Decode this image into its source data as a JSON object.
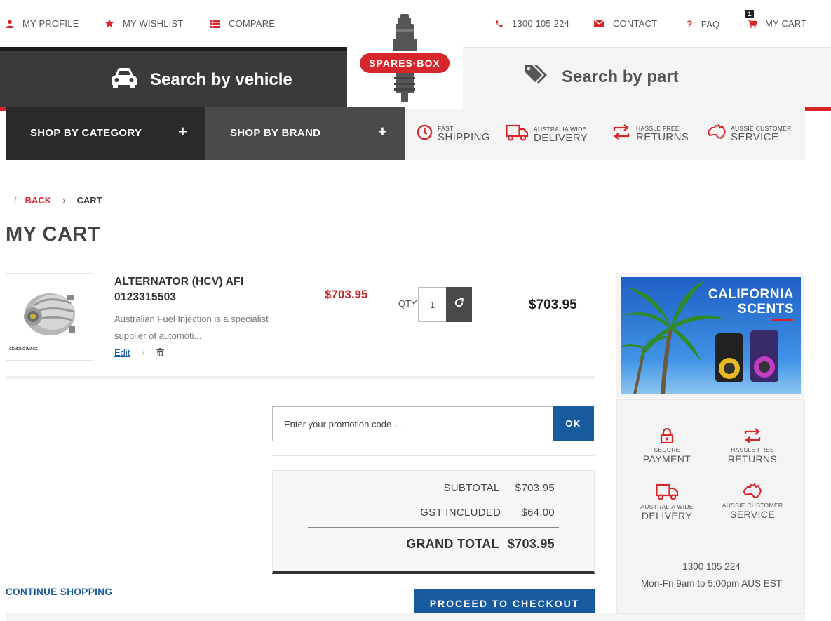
{
  "topnav": {
    "profile": "MY PROFILE",
    "wishlist": "MY WISHLIST",
    "compare": "COMPARE",
    "phone": "1300 105 224",
    "contact": "CONTACT",
    "faq": "FAQ",
    "cart": "MY CART",
    "cart_count": "1"
  },
  "logo": {
    "text": "SPARES·BOX"
  },
  "search_tabs": {
    "vehicle": "Search by vehicle",
    "part": "Search by part"
  },
  "shop_bar": {
    "category": "SHOP BY CATEGORY",
    "brand": "SHOP BY BRAND",
    "plus": "+"
  },
  "features": [
    {
      "small": "FAST",
      "big": "SHIPPING",
      "icon": "clock-icon"
    },
    {
      "small": "AUSTRALIA WIDE",
      "big": "DELIVERY",
      "icon": "truck-icon"
    },
    {
      "small": "HASSLE FREE",
      "big": "RETURNS",
      "icon": "returns-icon"
    },
    {
      "small": "AUSSIE CUSTOMER",
      "big": "SERVICE",
      "icon": "australia-icon"
    }
  ],
  "breadcrumb": {
    "sep": "/",
    "back": "BACK",
    "arrow": "›",
    "current": "CART"
  },
  "page_title": "MY CART",
  "item": {
    "name": "ALTERNATOR (HCV) AFI 0123315503",
    "description": "Australian Fuel Injection is a specialist supplier of automoti...",
    "image_caption": "GENERIC IMAGE",
    "edit": "Edit",
    "sep": "/",
    "price": "$703.95",
    "qty_label": "QTY",
    "qty": "1",
    "line_total": "$703.95"
  },
  "promo": {
    "placeholder": "Enter your promotion code ...",
    "button": "OK"
  },
  "totals": {
    "subtotal_label": "SUBTOTAL",
    "subtotal": "$703.95",
    "gst_label": "GST INCLUDED",
    "gst": "$64.00",
    "grand_label": "GRAND TOTAL",
    "grand": "$703.95"
  },
  "actions": {
    "continue": "CONTINUE SHOPPING",
    "checkout": "PROCEED TO CHECKOUT"
  },
  "sidebar": {
    "ad_title_1": "CALIFORNIA",
    "ad_title_2": "SCENTS",
    "items": [
      {
        "small": "SECURE",
        "big": "PAYMENT",
        "icon": "lock-icon"
      },
      {
        "small": "HASSLE FREE",
        "big": "RETURNS",
        "icon": "returns-icon"
      },
      {
        "small": "AUSTRALIA WIDE",
        "big": "DELIVERY",
        "icon": "truck-icon"
      },
      {
        "small": "AUSSIE CUSTOMER",
        "big": "SERVICE",
        "icon": "australia-icon"
      }
    ],
    "phone": "1300 105 224",
    "hours": "Mon-Fri 9am to 5:00pm AUS EST"
  },
  "colors": {
    "accent_red": "#d6262c",
    "brand_blue": "#175a9d",
    "dark": "#2a2a2a"
  }
}
